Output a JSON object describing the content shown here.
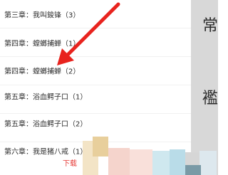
{
  "chapter_list": {
    "items": [
      {
        "label": "第三章：我叫鋑锋（3）"
      },
      {
        "label": "第四章：螳螂捕蝉（1）"
      },
      {
        "label": "第四章：螳螂捕蝉（2）"
      },
      {
        "label": "第五章：浴血鳄子口（1）"
      },
      {
        "label": "第五章：浴血鳄子口（2）"
      },
      {
        "label": "第六章：我是猪八戒（1）"
      }
    ]
  },
  "side_page": {
    "chars": [
      "常",
      "襤"
    ]
  },
  "download_text": "下载",
  "colors": {
    "arrow": "#e8231e",
    "download": "#e53935",
    "side_page_bg": "#d8d8d8"
  }
}
